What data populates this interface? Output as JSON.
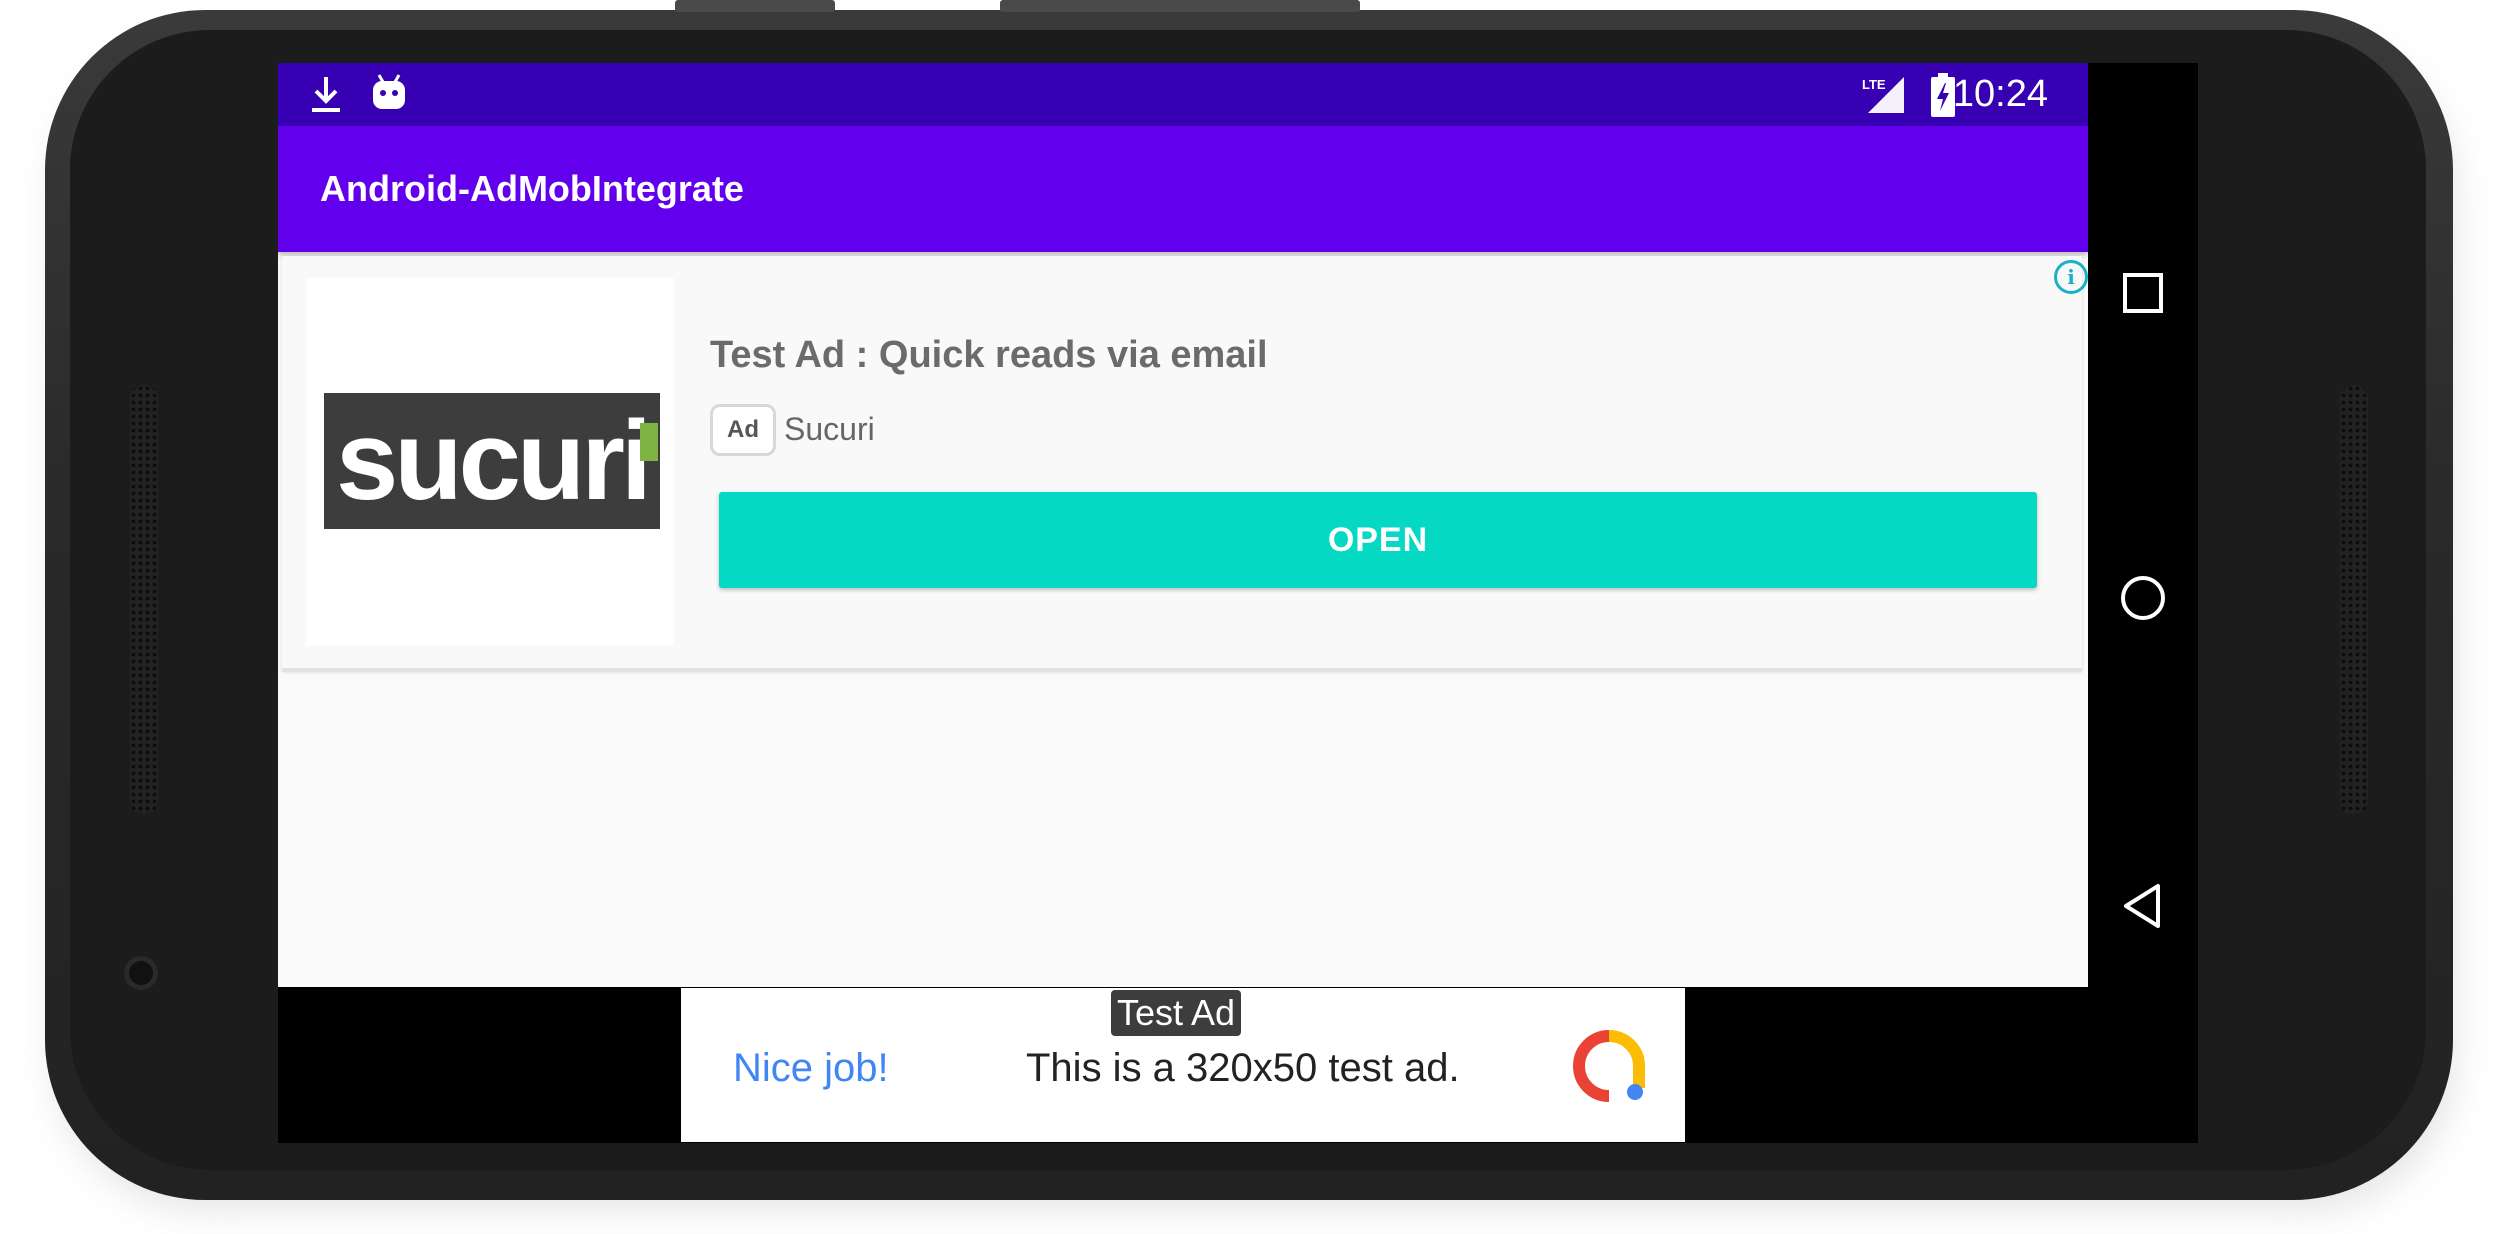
{
  "status_bar": {
    "time": "10:24",
    "network": "LTE",
    "left_icons": [
      "download-icon",
      "android-debug-icon"
    ],
    "right_icons": [
      "lte-signal-icon",
      "battery-charging-icon"
    ]
  },
  "app_bar": {
    "title": "Android-AdMobIntegrate"
  },
  "native_ad": {
    "logo_text": "sucuri",
    "headline": "Test Ad : Quick reads via email",
    "badge": "Ad",
    "advertiser": "Sucuri",
    "cta": "OPEN",
    "info_icon": "info-icon",
    "cta_color": "#05d8c3"
  },
  "banner_ad": {
    "label": "Test Ad",
    "nice_job": "Nice job!",
    "text": "This is a 320x50 test ad.",
    "logo_icon": "admob-logo-icon"
  },
  "nav_bar": {
    "buttons": [
      "recents-icon",
      "home-icon",
      "back-icon"
    ]
  },
  "colors": {
    "status_bar": "#3700b3",
    "app_bar": "#6200ee"
  }
}
